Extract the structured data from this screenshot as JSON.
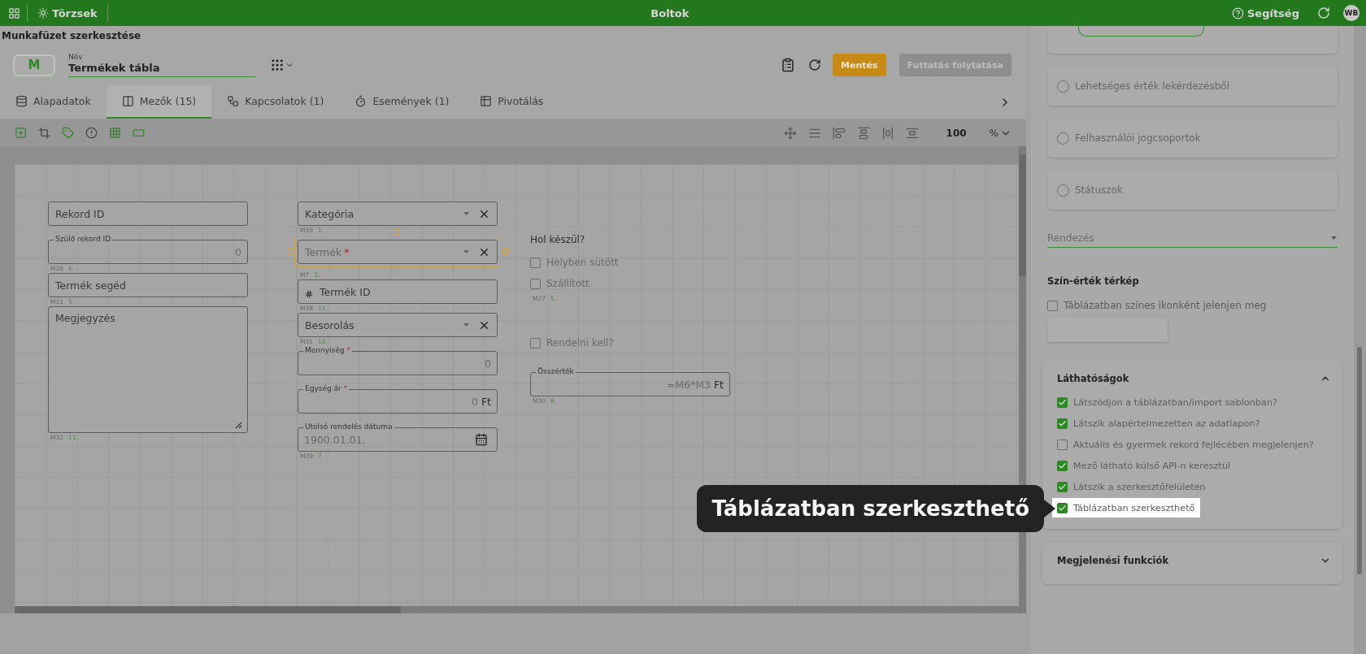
{
  "top_bar": {
    "section": "Törzsek",
    "title": "Boltok",
    "help": "Segítség",
    "avatar": "WB"
  },
  "page_title": "Munkafüzet szerkesztése",
  "header": {
    "logo": "M",
    "name_label": "Név",
    "name_value": "Termékek tábla",
    "buttons": [
      {
        "label": "Mentés",
        "kind": "primary"
      },
      {
        "label": "Futtatás folytatása",
        "kind": "disabled"
      }
    ]
  },
  "tabs": [
    {
      "label": "Alapadatok",
      "selected": false
    },
    {
      "label": "Mezők (15)",
      "selected": true
    },
    {
      "label": "Kapcsolatok (1)",
      "selected": false
    },
    {
      "label": "Események (1)",
      "selected": false
    },
    {
      "label": "Pivotálás",
      "selected": false
    }
  ],
  "canvas_toolbar": {
    "zoom": "100",
    "unit": "%"
  },
  "canvas": {
    "columns": [
      [
        {
          "kind": "text",
          "label": "Rekord ID",
          "selected": false
        },
        {
          "kind": "outlined",
          "label": "Szülő rekord ID",
          "value": "0",
          "selected": false,
          "code": {
            "id": "M20",
            "order": "6."
          }
        },
        {
          "kind": "text",
          "label": "Termék segéd",
          "selected": false,
          "code": {
            "id": "M11",
            "order": "5."
          }
        },
        {
          "kind": "textarea",
          "label": "Megjegyzés",
          "selected": false,
          "code": {
            "id": "M32",
            "order": "11."
          }
        }
      ],
      [
        {
          "kind": "select",
          "label": "Kategória",
          "selected": false,
          "code": {
            "id": "M39",
            "order": "1."
          }
        },
        {
          "kind": "select",
          "label": "Termék",
          "required_mark": "*",
          "selected": true,
          "code": {
            "id": "M7",
            "order": "2."
          }
        },
        {
          "kind": "id",
          "label": "Termék ID",
          "selected": false,
          "code": {
            "id": "M38",
            "order": "11."
          }
        },
        {
          "kind": "select",
          "label": "Besorolás",
          "selected": false,
          "code": {
            "id": "M31",
            "order": "10."
          }
        },
        {
          "kind": "outlined",
          "label": "Mennyiség",
          "required_mark": "*",
          "value": "0",
          "selected": false
        },
        {
          "kind": "outlined",
          "label": "Egység ár",
          "required_mark": "*",
          "value": "0",
          "suffix": "Ft",
          "selected": false
        },
        {
          "kind": "date",
          "label": "Utolsó rendelés dátuma",
          "value": "1900.01.01.",
          "selected": false,
          "code": {
            "id": "M29",
            "order": "7."
          }
        }
      ],
      [
        {
          "kind": "group",
          "label": "Hol készül?",
          "options": [
            {
              "label": "Helyben sütött",
              "checked": false
            },
            {
              "label": "Szállított",
              "checked": false
            }
          ],
          "selected": false,
          "code": {
            "id": "M27",
            "order": "5."
          }
        },
        {
          "kind": "checkbox",
          "label": "Rendelni kell?",
          "checked": false,
          "selected": false
        },
        {
          "kind": "outlined",
          "label": "Összérték",
          "value": "=M6*M3",
          "suffix": "Ft",
          "selected": false,
          "code": {
            "id": "M30",
            "order": "8."
          }
        }
      ]
    ]
  },
  "side_panel": {
    "sources": [
      {
        "label": "Lehetséges érték lekérdezésből",
        "selected": false
      },
      {
        "label": "Felhasználói jogcsoportok",
        "selected": false
      },
      {
        "label": "Státuszok",
        "selected": false
      }
    ],
    "sort_placeholder": "Rendezés",
    "color_map": {
      "title": "Szín-érték térkép",
      "option": {
        "label": "Táblázatban színes ikonként jelenjen meg",
        "checked": false
      }
    },
    "visibility": {
      "title": "Láthatóságok",
      "expanded": true,
      "items": [
        {
          "label": "Látszódjon a táblázatban/import sablonban?",
          "checked": true,
          "highlighted": false
        },
        {
          "label": "Látszik alapértelmezetten az adatlapon?",
          "checked": true,
          "highlighted": false
        },
        {
          "label": "Aktuális és gyermek rekord fejlécében megjelenjen?",
          "checked": false,
          "highlighted": false
        },
        {
          "label": "Mező látható külső API-n keresztül",
          "checked": true,
          "highlighted": false
        },
        {
          "label": "Látszik a szerkesztőfelületen",
          "checked": true,
          "highlighted": false
        },
        {
          "label": "Táblázatban szerkeszthető",
          "checked": true,
          "highlighted": true
        }
      ]
    },
    "display": {
      "title": "Megjelenési funkciók",
      "expanded": false
    }
  },
  "tooltip": "Táblázatban szerkeszthető"
}
